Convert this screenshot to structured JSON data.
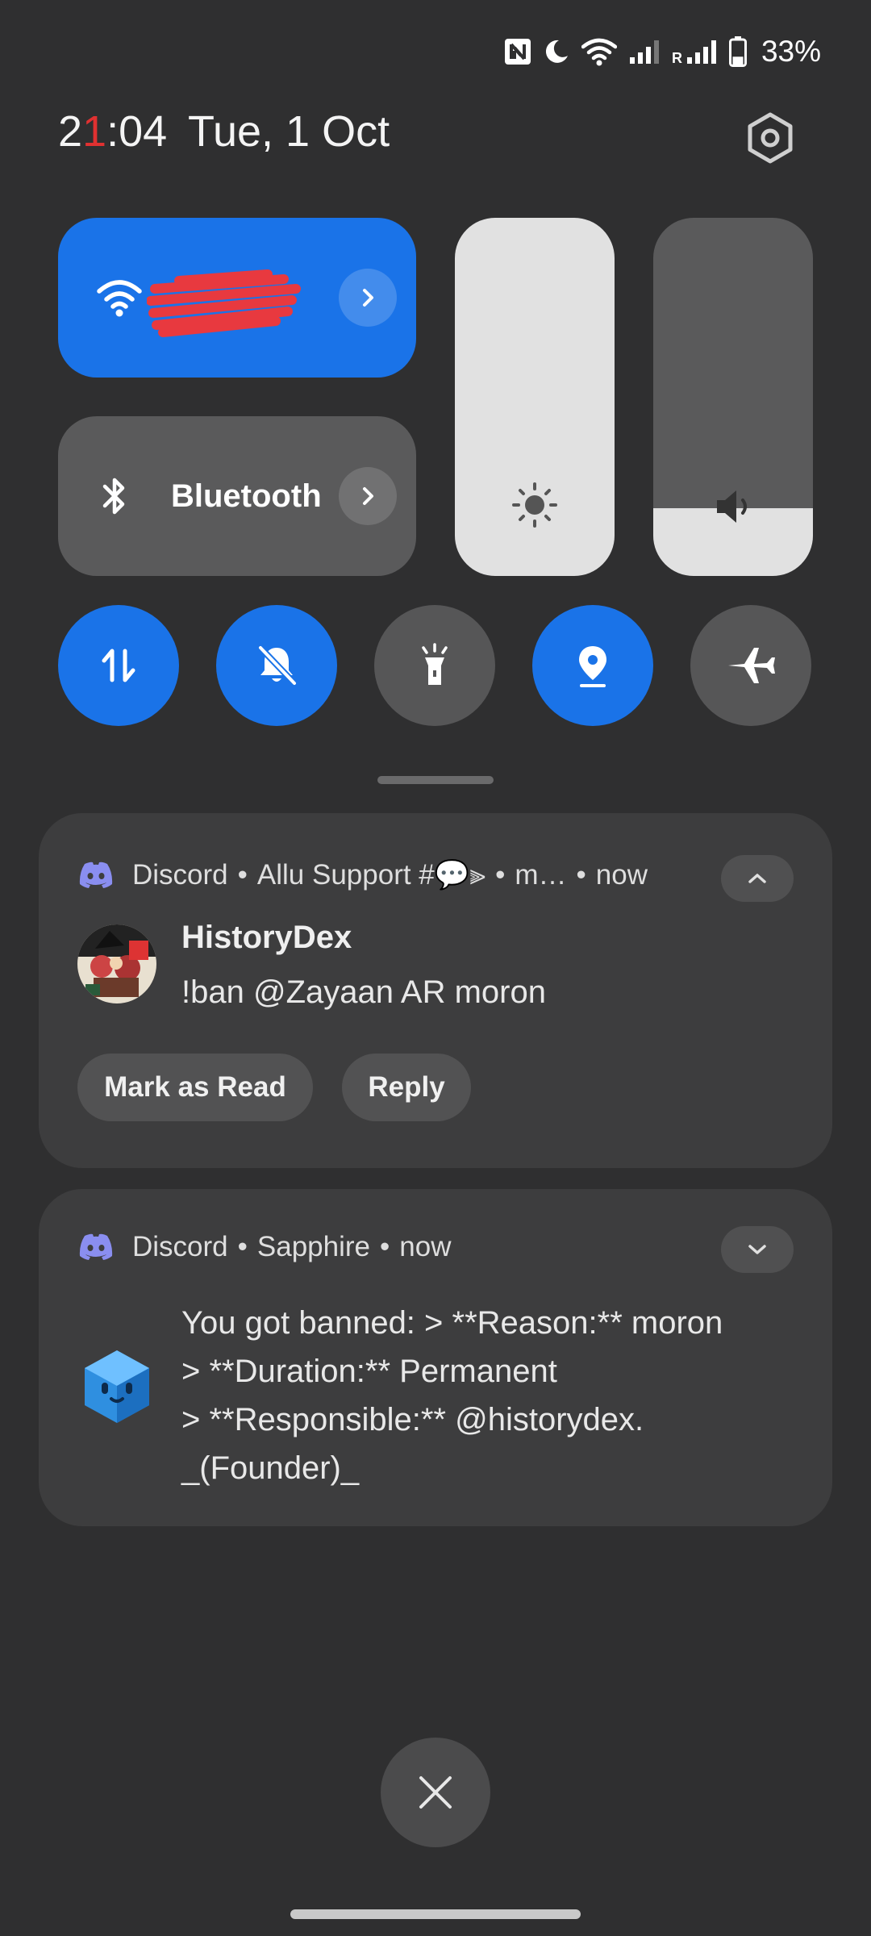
{
  "status_bar": {
    "battery_percent": "33%",
    "battery_level": 0.33,
    "icons": [
      "nfc-icon",
      "moon-icon",
      "wifi-icon",
      "signal-icon",
      "roaming-signal-icon",
      "battery-icon"
    ],
    "roaming_label": "R"
  },
  "header": {
    "time_prefix": "2",
    "time_accent": "1",
    "time_suffix": ":04",
    "date": "Tue, 1 Oct",
    "accent_color": "#e03131"
  },
  "quick_settings": {
    "wifi": {
      "active": true,
      "network_name_redacted": true
    },
    "bluetooth": {
      "label": "Bluetooth",
      "active": false
    },
    "brightness_level": 1.0,
    "volume_level": 0.19,
    "toggles": [
      {
        "name": "mobile-data",
        "icon": "data-arrows-icon",
        "active": true
      },
      {
        "name": "silent",
        "icon": "bell-off-icon",
        "active": true
      },
      {
        "name": "flashlight",
        "icon": "flashlight-icon",
        "active": false
      },
      {
        "name": "location",
        "icon": "location-pin-icon",
        "active": true
      },
      {
        "name": "airplane-mode",
        "icon": "airplane-icon",
        "active": false
      }
    ],
    "accent": "#1a73e8"
  },
  "notifications": [
    {
      "app": "Discord",
      "context": "Allu Support #💬⫸",
      "context_trail": "m…",
      "time": "now",
      "sender": "HistoryDex",
      "message": "!ban @Zayaan AR moron",
      "actions": [
        "Mark as Read",
        "Reply"
      ],
      "expanded": true
    },
    {
      "app": "Discord",
      "context": "Sapphire",
      "time": "now",
      "message_lines": [
        "You got banned: > **Reason:** moron",
        "> **Duration:** Permanent",
        "> **Responsible:** @historydex.",
        "_(Founder)_"
      ],
      "expanded": false
    }
  ],
  "separator": "•"
}
